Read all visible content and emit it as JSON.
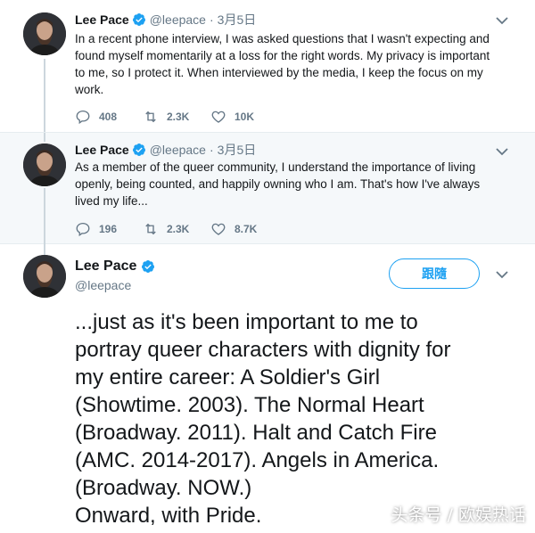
{
  "colors": {
    "accent": "#1da1f2",
    "muted": "#657786",
    "thread_line": "#ccd6dd"
  },
  "tweets": [
    {
      "name": "Lee Pace",
      "handle": "@leepace",
      "dot": "·",
      "date": "3月5日",
      "text": "In a recent phone interview, I was asked questions that I wasn't expecting and found myself momentarily at a loss for the right words. My privacy is important to me, so I protect it. When interviewed by the media, I keep the focus on my work.",
      "replies": "408",
      "retweets": "2.3K",
      "likes": "10K"
    },
    {
      "name": "Lee Pace",
      "handle": "@leepace",
      "dot": "·",
      "date": "3月5日",
      "text": "As a member of the queer community, I understand the importance of living openly, being counted, and happily owning who I am. That's how I've always lived my life...",
      "replies": "196",
      "retweets": "2.3K",
      "likes": "8.7K"
    }
  ],
  "main_tweet": {
    "name": "Lee Pace",
    "handle": "@leepace",
    "follow_label": "跟隨",
    "text": "...just as it's been important to me to\nportray queer characters with dignity for\nmy entire career: A Soldier's Girl\n(Showtime. 2003). The Normal Heart\n(Broadway. 2011). Halt and Catch Fire\n(AMC. 2014-2017). Angels in America.\n(Broadway. NOW.)\nOnward, with Pride."
  },
  "watermark": "头条号 / 欧娱热话",
  "icons": [
    "verified-badge-icon",
    "caret-down-icon",
    "reply-icon",
    "retweet-icon",
    "like-icon",
    "avatar"
  ]
}
